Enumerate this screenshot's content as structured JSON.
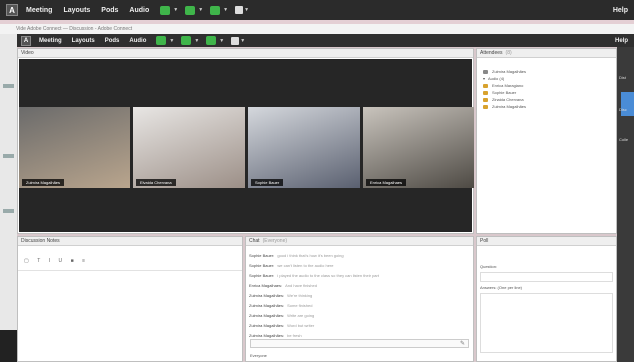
{
  "outer_menu": {
    "logo": "A",
    "items": [
      "Meeting",
      "Layouts",
      "Pods",
      "Audio"
    ],
    "help": "Help"
  },
  "window_title": "Vide  Adobe Connect — Discussion - Adobe Connect",
  "inner_menu": {
    "logo": "A",
    "items": [
      "Meeting",
      "Layouts",
      "Pods",
      "Audio"
    ],
    "help": "Help"
  },
  "video_pod": {
    "title": "Video",
    "tiles": [
      {
        "name": "Zulmira Magalhães",
        "colors": [
          "#6b6b6b",
          "#b9a58d"
        ]
      },
      {
        "name": "Elvaida Chervana",
        "colors": [
          "#e8e6e4",
          "#9c8f87"
        ]
      },
      {
        "name": "Sophie Bauer",
        "colors": [
          "#d5d8dd",
          "#5a6070"
        ]
      },
      {
        "name": "Enrica Magalhaes",
        "colors": [
          "#c9c4bd",
          "#4e4a44"
        ]
      }
    ]
  },
  "attendees_pod": {
    "title": "Attendees",
    "count": "(8)",
    "host": "Zulmira Magalhães",
    "group": "Audio (4)",
    "members": [
      "Enrica Maragiano",
      "Sophie Bauer",
      "Zinaida Chervana",
      "Zulmira Magalhães"
    ]
  },
  "notes_pod": {
    "title": "Discussion Notes"
  },
  "chat_pod": {
    "title": "Chat",
    "subtitle": "(Everyone)",
    "messages": [
      {
        "who": "Sophie Bauer:",
        "text": "good i think that's how it's been going"
      },
      {
        "who": "Sophie Bauer:",
        "text": "we can't listen to the audio here"
      },
      {
        "who": "Sophie Bauer:",
        "text": "i played the audio to the class so they can listen their part"
      },
      {
        "who": "Enrica Magalhaes:",
        "text": "And have finished"
      },
      {
        "who": "Zulmira Magalhães:",
        "text": "We're thinking"
      },
      {
        "who": "Zulmira Magalhães:",
        "text": "Some finished"
      },
      {
        "who": "Zulmira Magalhães:",
        "text": "Write are going"
      },
      {
        "who": "Zulmira Magalhães:",
        "text": "Word but writer"
      },
      {
        "who": "Zulmira Magalhães:",
        "text": "be fresh"
      }
    ],
    "input_label": "Everyone"
  },
  "poll_pod": {
    "title": "Poll",
    "question": "Question:",
    "answer": "Answers: (One per line)"
  },
  "right_strip": {
    "labels": [
      "Dist",
      "Disc",
      "Colle"
    ]
  },
  "colors": {
    "audio_green": "#3fb54a",
    "attendee_icon": "#d8a22e"
  }
}
